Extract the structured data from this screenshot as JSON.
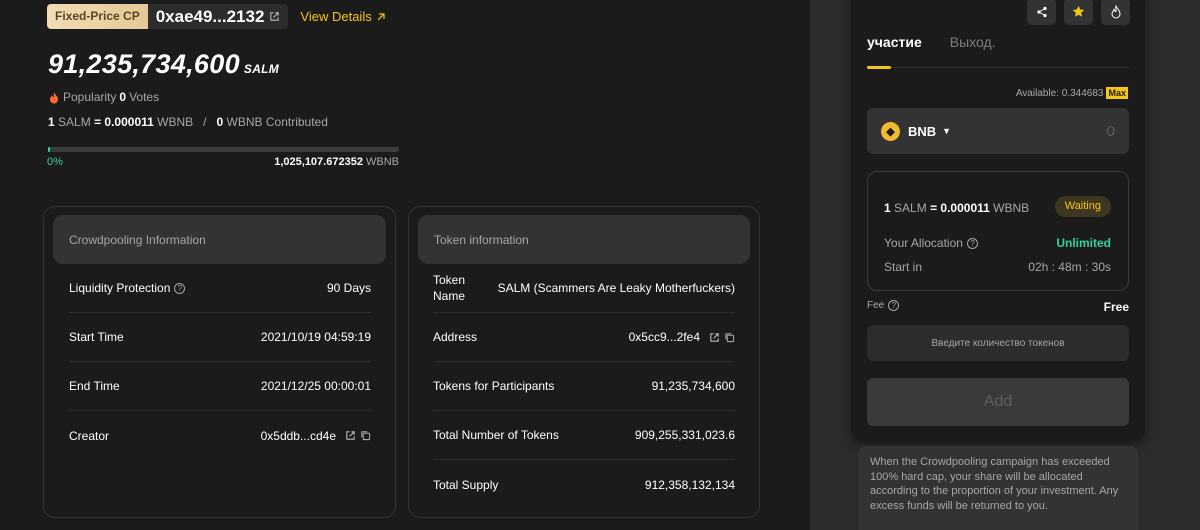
{
  "header": {
    "badge": "Fixed-Price CP",
    "address": "0xae49...2132",
    "view_details": "View Details"
  },
  "summary": {
    "amount": "91,235,734,600",
    "unit": "SALM",
    "popularity_label": "Popularity",
    "popularity_count": "0",
    "votes_label": "Votes",
    "rate_prefix": "1",
    "rate_token": "SALM",
    "rate_value": "0.000011",
    "rate_quote": "WBNB",
    "contributed_amount": "0",
    "contributed_label": "WBNB Contributed",
    "progress_percent": 0,
    "progress_label": "0%",
    "hard_cap": "1,025,107.672352",
    "hard_cap_unit": "WBNB"
  },
  "crowdpooling": {
    "title": "Crowdpooling Information",
    "rows": [
      {
        "label": "Liquidity Protection",
        "value": "90 Days"
      },
      {
        "label": "Start Time",
        "value": "2021/10/19 04:59:19"
      },
      {
        "label": "End Time",
        "value": "2021/12/25 00:00:01"
      },
      {
        "label": "Creator",
        "value": "0x5ddb...cd4e"
      }
    ]
  },
  "token": {
    "title": "Token information",
    "rows": [
      {
        "label": "Token Name",
        "value": "SALM (Scammers Are Leaky Motherfuckers)"
      },
      {
        "label": "Address",
        "value": "0x5cc9...2fe4"
      },
      {
        "label": "Tokens for Participants",
        "value": "91,235,734,600"
      },
      {
        "label": "Total Number of Tokens",
        "value": "909,255,331,023.6"
      },
      {
        "label": "Total Supply",
        "value": "912,358,132,134"
      }
    ]
  },
  "panel": {
    "tabs": [
      {
        "label": "участие",
        "active": true
      },
      {
        "label": "Выход.",
        "active": false
      }
    ],
    "available_label": "Available: 0.344683",
    "max_label": "Max",
    "token_symbol": "BNB",
    "input_value": "0",
    "rate_prefix": "1",
    "rate_token": "SALM",
    "rate_value": "0.000011",
    "rate_quote": "WBNB",
    "status": "Waiting",
    "allocation_label": "Your Allocation",
    "allocation_value": "Unlimited",
    "start_label": "Start in",
    "start_value": "02h : 48m : 30s",
    "fee_label": "Fee",
    "fee_value": "Free",
    "hint": "Введите количество токенов",
    "add_label": "Add"
  },
  "note": "When the Crowdpooling campaign has exceeded 100% hard cap, your share will be allocated according to the proportion of your investment. Any excess funds will be returned to you.",
  "colors": {
    "accent": "#f5c518",
    "success": "#34d39b",
    "bnb": "#f3ba2f"
  }
}
